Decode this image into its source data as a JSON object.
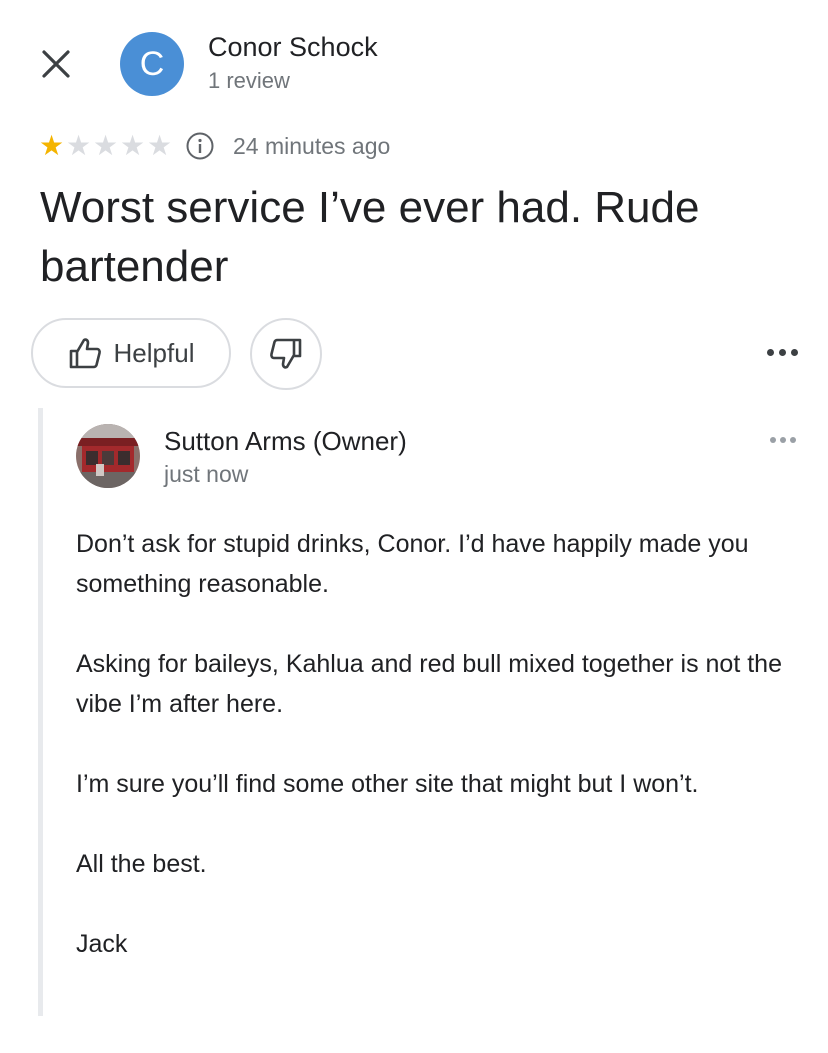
{
  "reviewer": {
    "initial": "C",
    "name": "Conor Schock",
    "meta": "1 review"
  },
  "review": {
    "rating": 1,
    "max_rating": 5,
    "time_ago": "24 minutes ago",
    "text": "Worst service I’ve ever had. Rude bartender"
  },
  "actions": {
    "helpful_label": "Helpful"
  },
  "owner_reply": {
    "name": "Sutton Arms (Owner)",
    "time": "just now",
    "paragraphs": [
      "Don’t ask for stupid drinks, Conor. I’d have happily made you something reasonable.",
      "Asking for baileys, Kahlua and red bull mixed together is not the vibe I’m after here.",
      "I’m sure you’ll find some other site that might but I won’t.",
      "All the best.",
      "Jack"
    ]
  },
  "colors": {
    "avatar_blue": "#4a8fd6",
    "star_filled": "#f4b400",
    "star_empty": "#dadce0",
    "text_primary": "#202124",
    "text_secondary": "#70757a"
  },
  "icons": [
    "close-icon",
    "star-icon",
    "info-icon",
    "thumbs-up-icon",
    "thumbs-down-icon",
    "more-vert-icon"
  ]
}
